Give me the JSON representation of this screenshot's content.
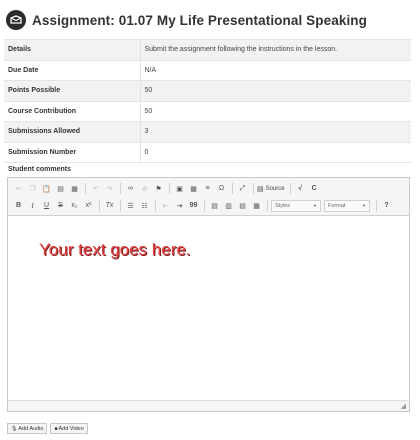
{
  "header": {
    "title": "Assignment: 01.07 My Life Presentational Speaking",
    "icon": "assignment-icon"
  },
  "details": [
    {
      "label": "Details",
      "value": "Submit the assignment following the instructions in the lesson."
    },
    {
      "label": "Due Date",
      "value": "N/A"
    },
    {
      "label": "Points Possible",
      "value": "50"
    },
    {
      "label": "Course Contribution",
      "value": "50"
    },
    {
      "label": "Submissions Allowed",
      "value": "3"
    },
    {
      "label": "Submission Number",
      "value": "0"
    }
  ],
  "comments": {
    "label": "Student comments",
    "placeholder_overlay": "Your text goes here."
  },
  "toolbar": {
    "source_label": "Source",
    "styles_label": "Styles",
    "format_label": "Format",
    "bold": "B",
    "italic": "I",
    "underline": "U",
    "strike": "S",
    "subscript": "x₂",
    "superscript": "x²",
    "remove_format": "Tx",
    "special_char": "Ω",
    "blockquote": "99",
    "help": "?"
  },
  "buttons": {
    "add_audio": "Add Audio",
    "add_video": "Add Video"
  },
  "colors": {
    "overlay_text": "#e74040",
    "row_alt": "#f2f2f2",
    "header_icon_bg": "#2b2b2b"
  }
}
